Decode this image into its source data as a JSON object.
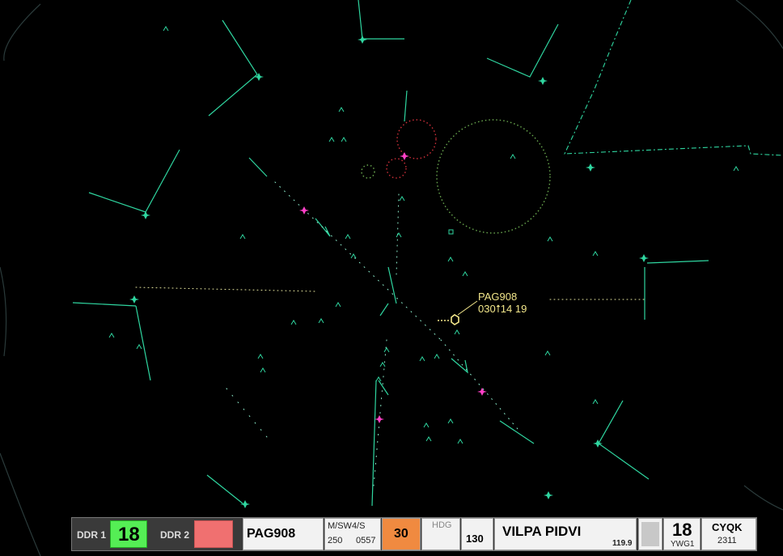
{
  "target": {
    "callsign": "PAG908",
    "data_line": "030⭡14 19"
  },
  "strip": {
    "ddr1_label": "DDR 1",
    "ddr1_value": "18",
    "ddr2_label": "DDR 2",
    "callsign": "PAG908",
    "type_line": "M/SW4/S",
    "speed": "250",
    "time": "0557",
    "assigned_alt": "30",
    "hdg_label": "HDG",
    "alt_value": "130",
    "route": "VILPA PIDVI",
    "freq": "119.9",
    "sector_num": "18",
    "sector_code": "YWG1",
    "dest": "CYQK",
    "squawk": "2311"
  },
  "colors": {
    "background": "#000000",
    "map_lines": "#2fd6a0",
    "target": "#f2e68a",
    "fix_magenta": "#ff40c8",
    "restricted_red": "#d0303a",
    "ddr1_green": "#55ee55",
    "ddr2_red": "#f07070",
    "alt_orange": "#f08a40"
  }
}
